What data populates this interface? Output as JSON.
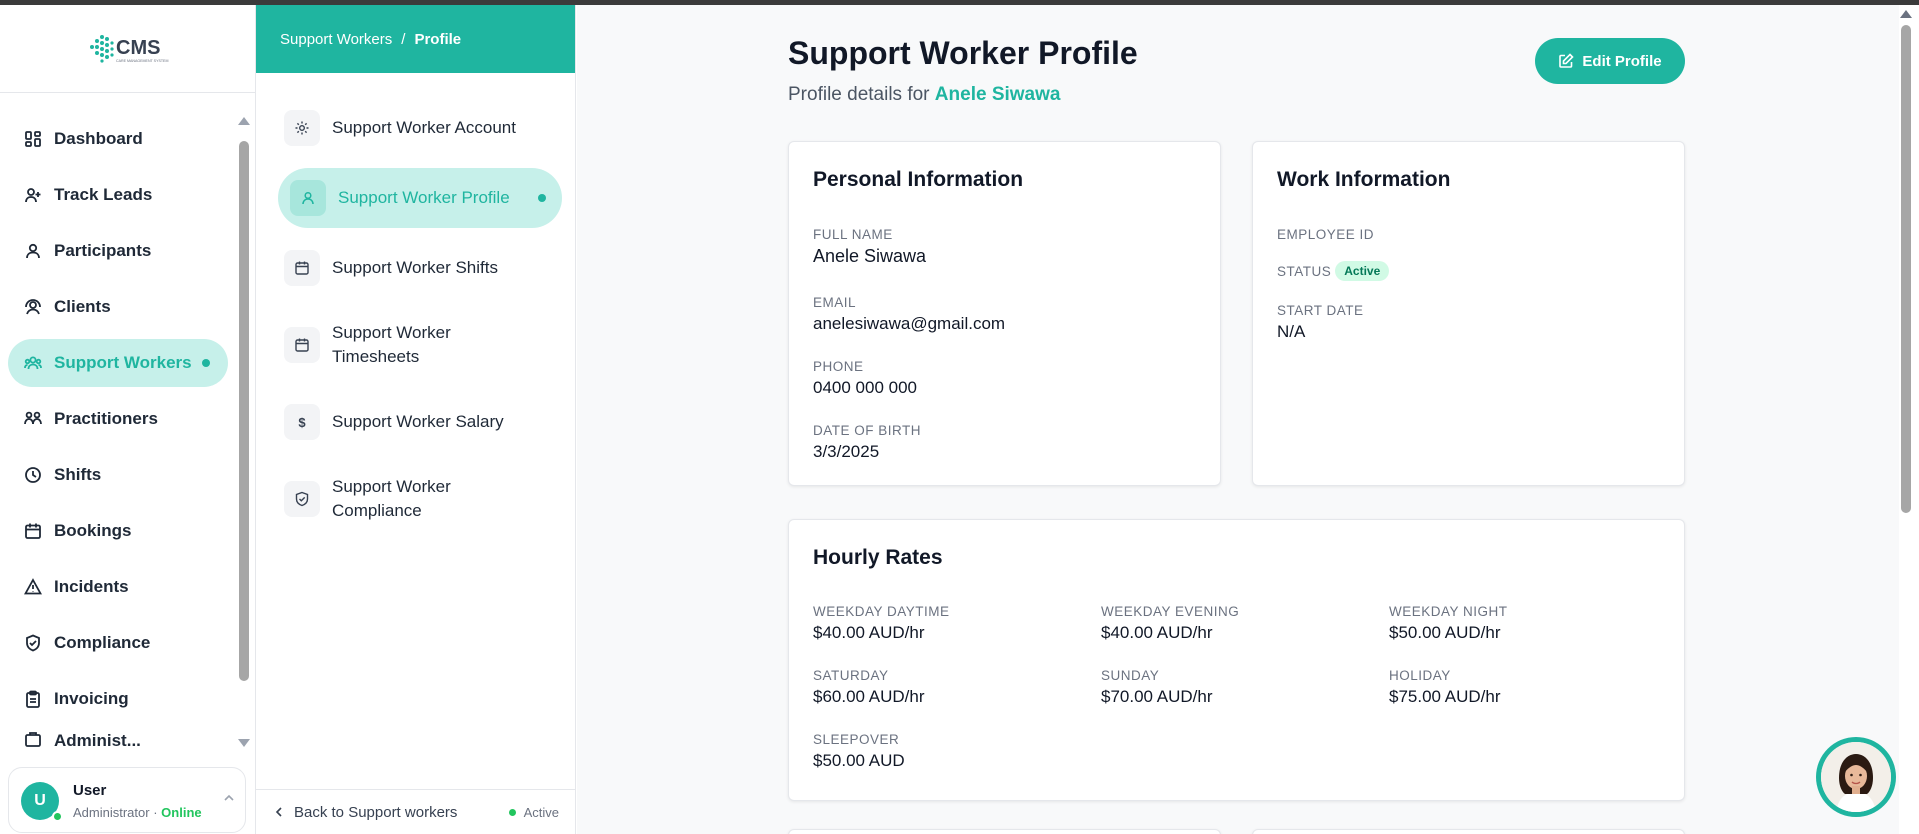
{
  "app": {
    "logo_text": "CMS",
    "logo_tagline": "CARE MANAGEMENT SYSTEM"
  },
  "sidebar": {
    "items": [
      {
        "label": "Dashboard",
        "icon": "dashboard-icon"
      },
      {
        "label": "Track Leads",
        "icon": "user-plus-icon"
      },
      {
        "label": "Participants",
        "icon": "user-icon"
      },
      {
        "label": "Clients",
        "icon": "user-circle-icon"
      },
      {
        "label": "Support Workers",
        "icon": "users-icon",
        "active": true
      },
      {
        "label": "Practitioners",
        "icon": "practitioners-icon"
      },
      {
        "label": "Shifts",
        "icon": "clock-icon"
      },
      {
        "label": "Bookings",
        "icon": "calendar-icon"
      },
      {
        "label": "Incidents",
        "icon": "warning-icon"
      },
      {
        "label": "Compliance",
        "icon": "shield-icon"
      },
      {
        "label": "Invoicing",
        "icon": "clipboard-icon"
      },
      {
        "label": "Administ...",
        "icon": "admin-icon"
      }
    ],
    "user": {
      "initial": "U",
      "name": "User",
      "role": "Administrator",
      "separator": "·",
      "status": "Online"
    }
  },
  "subnav": {
    "breadcrumb": {
      "parent": "Support Workers",
      "separator": "/",
      "current": "Profile"
    },
    "items": [
      {
        "label": "Support Worker Account",
        "icon": "gear-icon"
      },
      {
        "label": "Support Worker Profile",
        "icon": "user-icon",
        "active": true
      },
      {
        "label": "Support Worker Shifts",
        "icon": "calendar-icon"
      },
      {
        "label": "Support Worker Timesheets",
        "icon": "calendar-icon"
      },
      {
        "label": "Support Worker Salary",
        "icon": "dollar-icon",
        "glyph": "$"
      },
      {
        "label": "Support Worker Compliance",
        "icon": "shield-check-icon"
      }
    ],
    "back_label": "Back to Support workers",
    "footer_status": "Active"
  },
  "main": {
    "title": "Support Worker Profile",
    "subtitle_prefix": "Profile details for",
    "subtitle_name": "Anele Siwawa",
    "edit_label": "Edit Profile",
    "personal": {
      "title": "Personal Information",
      "full_name_label": "FULL NAME",
      "full_name": "Anele Siwawa",
      "email_label": "EMAIL",
      "email": "anelesiwawa@gmail.com",
      "phone_label": "PHONE",
      "phone": "0400 000 000",
      "dob_label": "DATE OF BIRTH",
      "dob": "3/3/2025"
    },
    "work": {
      "title": "Work Information",
      "employee_id_label": "EMPLOYEE ID",
      "status_label": "STATUS",
      "status": "Active",
      "start_date_label": "START DATE",
      "start_date": "N/A"
    },
    "rates": {
      "title": "Hourly Rates",
      "items": [
        {
          "label": "WEEKDAY DAYTIME",
          "value": "$40.00 AUD/hr"
        },
        {
          "label": "WEEKDAY EVENING",
          "value": "$40.00 AUD/hr"
        },
        {
          "label": "WEEKDAY NIGHT",
          "value": "$50.00 AUD/hr"
        },
        {
          "label": "SATURDAY",
          "value": "$60.00 AUD/hr"
        },
        {
          "label": "SUNDAY",
          "value": "$70.00 AUD/hr"
        },
        {
          "label": "HOLIDAY",
          "value": "$75.00 AUD/hr"
        },
        {
          "label": "SLEEPOVER",
          "value": "$50.00 AUD"
        }
      ]
    }
  },
  "colors": {
    "accent": "#1fb5a0",
    "accent_light": "#c6f0ea",
    "online": "#22c55e"
  }
}
